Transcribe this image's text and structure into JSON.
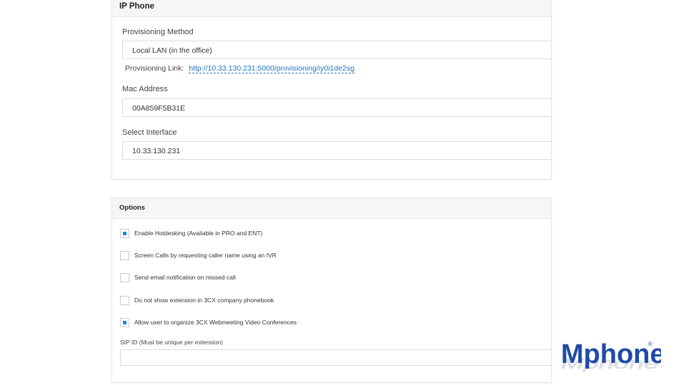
{
  "ip_phone": {
    "title": "IP Phone",
    "provisioning_method_label": "Provisioning Method",
    "provisioning_method_value": "Local LAN (in the office)",
    "provisioning_link_label": "Provisioning Link:",
    "provisioning_link_url": "http://10.33.130.231:5000/provisioning/iy0i1de2sg",
    "mac_address_label": "Mac Address",
    "mac_address_value": "00A859F5B31E",
    "select_interface_label": "Select Interface",
    "select_interface_value": "10.33.130.231"
  },
  "options": {
    "title": "Options",
    "items": [
      {
        "label": "Enable Hotdesking (Available in PRO and ENT)",
        "checked": true
      },
      {
        "label": "Screen Calls by requesting caller name using an IVR",
        "checked": false
      },
      {
        "label": "Send email notification on missed call",
        "checked": false
      },
      {
        "label": "Do not show extension in 3CX company phonebook",
        "checked": false
      },
      {
        "label": "Allow user to organize 3CX Webmeeting Video Conferences",
        "checked": true
      }
    ],
    "sip_id_label": "SIP ID (Must be unique per extension)",
    "sip_id_value": ""
  },
  "logo": {
    "text": "Mphone",
    "mark": "®",
    "color": "#1f4aa8"
  }
}
